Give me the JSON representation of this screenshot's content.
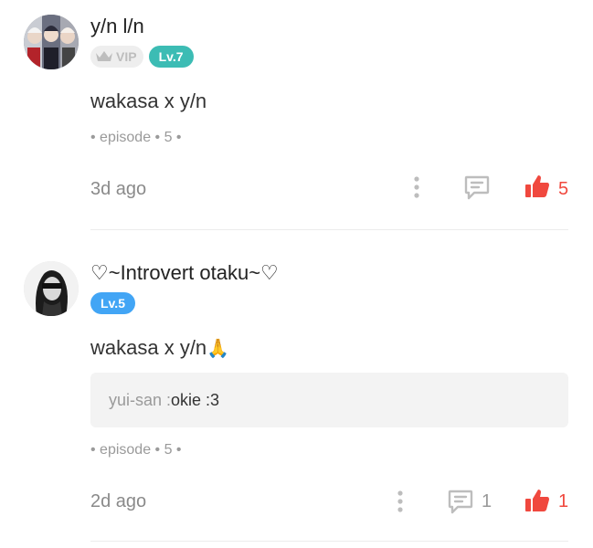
{
  "comments": [
    {
      "username": "y/n l/n",
      "vip_label": "VIP",
      "level": "Lv.7",
      "level_color": "#3cbcb4",
      "text": "wakasa x y/n",
      "meta": "• episode • 5 •",
      "time": "3d ago",
      "reply_count": "",
      "like_count": "5"
    },
    {
      "username": "♡~Introvert otaku~♡",
      "level": "Lv.5",
      "level_color": "#42a5f5",
      "text": "wakasa x y/n",
      "emoji": "🙏",
      "reply": {
        "author": "yui-san : ",
        "text": "okie :3"
      },
      "meta": "• episode • 5 •",
      "time": "2d ago",
      "reply_count": "1",
      "like_count": "1"
    }
  ],
  "colors": {
    "like": "#f0483e",
    "icon_gray": "#bdbdbd",
    "count_gray": "#9a9a9a"
  },
  "icons": [
    "crown-icon",
    "more-vertical-icon",
    "comment-icon",
    "thumbs-up-icon"
  ]
}
